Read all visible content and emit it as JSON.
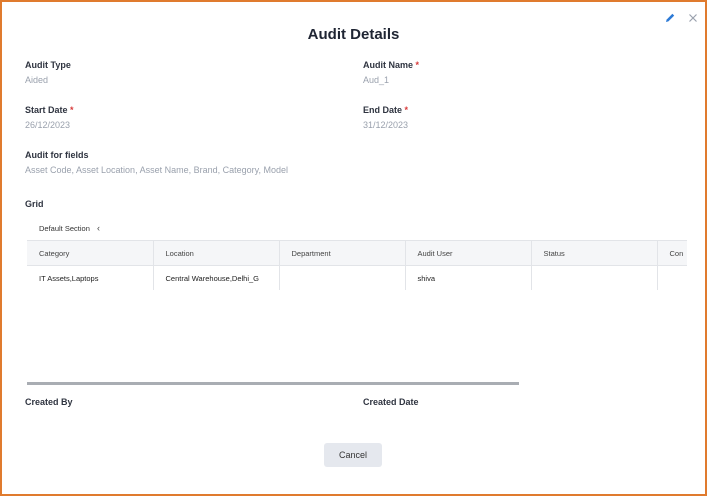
{
  "dialog": {
    "title": "Audit Details"
  },
  "fields": {
    "audit_type": {
      "label": "Audit Type",
      "value": "Aided"
    },
    "audit_name": {
      "label": "Audit Name",
      "required": "*",
      "value": "Aud_1"
    },
    "start_date": {
      "label": "Start Date",
      "required": "*",
      "value": "26/12/2023"
    },
    "end_date": {
      "label": "End Date",
      "required": "*",
      "value": "31/12/2023"
    },
    "audit_for_fields": {
      "label": "Audit for fields",
      "value": "Asset Code, Asset Location, Asset Name, Brand, Category, Model"
    },
    "grid_label": "Grid",
    "created_by": {
      "label": "Created By"
    },
    "created_date": {
      "label": "Created Date"
    }
  },
  "grid": {
    "section_tab": "Default Section",
    "columns": [
      "Category",
      "Location",
      "Department",
      "Audit User",
      "Status",
      "Con"
    ],
    "rows": [
      [
        "IT Assets,Laptops",
        "Central Warehouse,Delhi_G",
        "",
        "shiva",
        "",
        ""
      ]
    ]
  },
  "buttons": {
    "cancel": "Cancel"
  },
  "icons": {
    "edit": "pencil-icon",
    "close": "close-icon"
  },
  "colors": {
    "border": "#e07b2e",
    "required": "#d83a3a",
    "edit_icon": "#2d7ad6"
  }
}
